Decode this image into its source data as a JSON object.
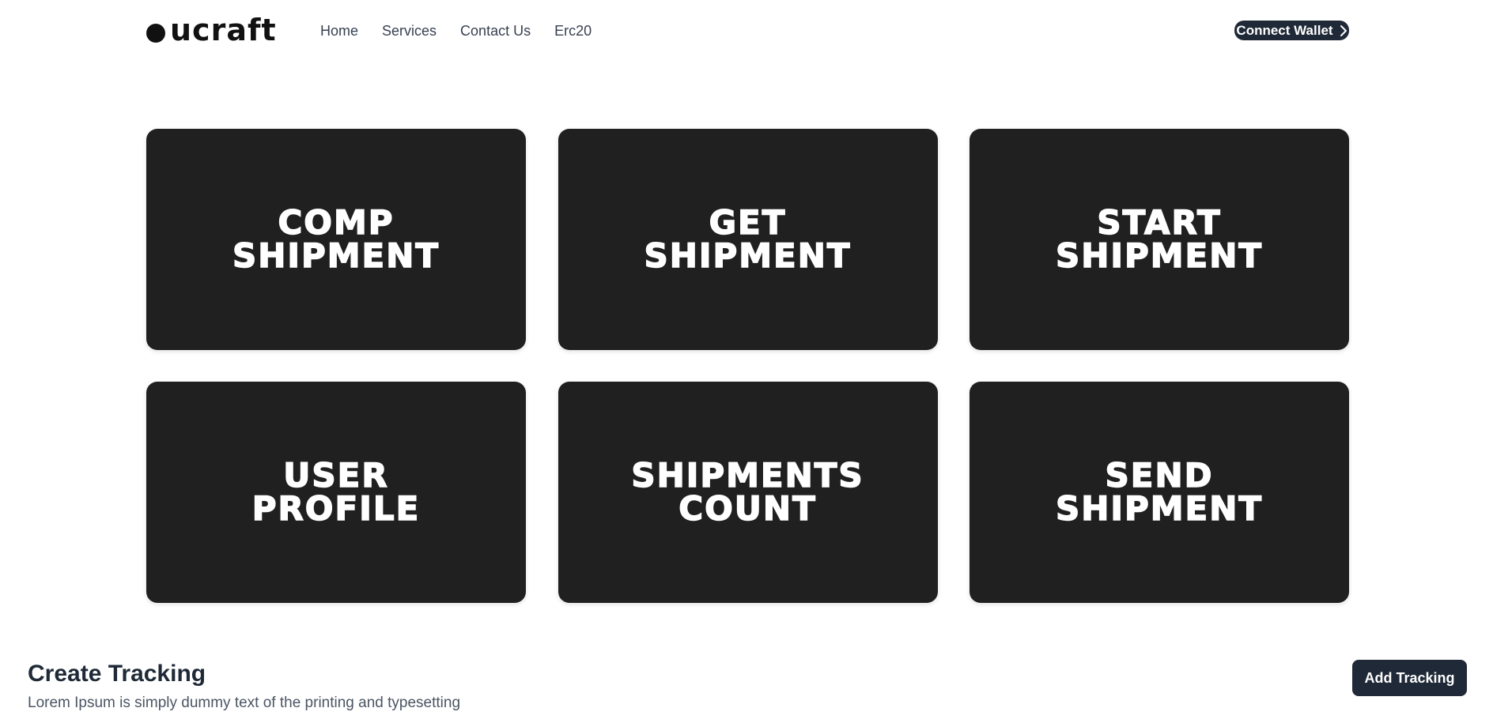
{
  "header": {
    "logo_text": "ucraft",
    "nav": [
      {
        "label": "Home"
      },
      {
        "label": "Services"
      },
      {
        "label": "Contact Us"
      },
      {
        "label": "Erc20"
      }
    ],
    "connect_label": "Connect Wallet",
    "connect_icon": "chevron-right-icon"
  },
  "cards": [
    {
      "line1": "COMP",
      "line2": "SHIPMENT"
    },
    {
      "line1": "GET",
      "line2": "SHIPMENT"
    },
    {
      "line1": "START",
      "line2": "SHIPMENT"
    },
    {
      "line1": "USER",
      "line2": "PROFILE"
    },
    {
      "line1": "SHIPMENTS",
      "line2": "COUNT"
    },
    {
      "line1": "SEND",
      "line2": "SHIPMENT"
    }
  ],
  "tracking": {
    "title": "Create Tracking",
    "description": "Lorem Ipsum is simply dummy text of the printing and typesetting",
    "add_label": "Add Tracking"
  },
  "colors": {
    "card_bg": "#202020",
    "button_bg": "#1f2937",
    "text_dark": "#1f2937"
  }
}
